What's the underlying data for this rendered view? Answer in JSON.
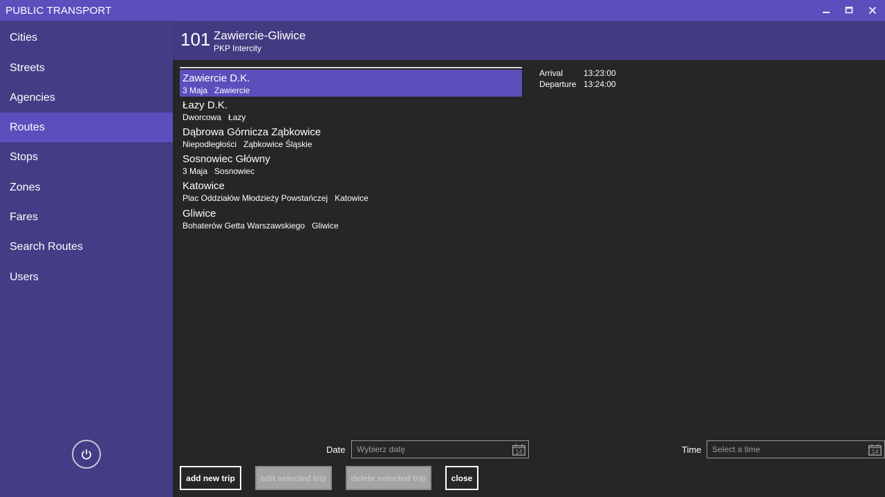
{
  "window": {
    "title": "PUBLIC TRANSPORT",
    "controls": [
      "minimize-icon",
      "maximize-icon",
      "close-icon"
    ]
  },
  "sidebar": {
    "items": [
      {
        "label": "Cities"
      },
      {
        "label": "Streets"
      },
      {
        "label": "Agencies"
      },
      {
        "label": "Routes",
        "active": true
      },
      {
        "label": "Stops"
      },
      {
        "label": "Zones"
      },
      {
        "label": "Fares"
      },
      {
        "label": "Search Routes"
      },
      {
        "label": "Users"
      }
    ],
    "power_icon": "power-icon"
  },
  "route": {
    "number": "101",
    "name": "Zawiercie-Gliwice",
    "agency": "PKP Intercity"
  },
  "stops": [
    {
      "name": "Zawiercie D.K.",
      "street": "3 Maja",
      "city": "Zawiercie",
      "selected": true
    },
    {
      "name": "Łazy D.K.",
      "street": "Dworcowa",
      "city": "Łazy"
    },
    {
      "name": "Dąbrowa Górnicza Ząbkowice",
      "street": "Niepodległości",
      "city": "Ząbkowice Śląskie"
    },
    {
      "name": "Sosnowiec Główny",
      "street": "3 Maja",
      "city": "Sosnowiec"
    },
    {
      "name": "Katowice",
      "street": "Plac Oddziałów Młodzieży Powstańczej",
      "city": "Katowice"
    },
    {
      "name": "Gliwice",
      "street": "Bohaterów Getta Warszawskiego",
      "city": "Gliwice"
    }
  ],
  "details": {
    "arrival_label": "Arrival",
    "arrival_value": "13:23:00",
    "departure_label": "Departure",
    "departure_value": "13:24:00"
  },
  "date": {
    "label": "Date",
    "placeholder": "Wybierz datę",
    "icon": "calendar-icon",
    "icon_text": "14"
  },
  "time": {
    "label": "Time",
    "placeholder": "Select a time",
    "icon": "calendar-icon",
    "icon_text": "14"
  },
  "buttons": {
    "add": "add new trip",
    "edit": "edit selected trip",
    "delete": "delete selected trip",
    "close": "close"
  },
  "colors": {
    "titlebar": "#5b4fbd",
    "sidebar": "#443c84",
    "header": "#433b82",
    "selected": "#5b4fbd",
    "background": "#262626"
  }
}
